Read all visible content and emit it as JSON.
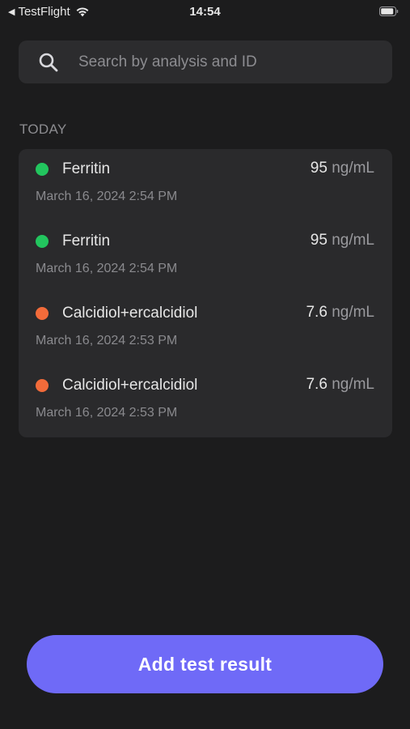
{
  "status_bar": {
    "back_label": "TestFlight",
    "time": "14:54"
  },
  "search": {
    "placeholder": "Search by analysis and ID"
  },
  "section": {
    "title": "TODAY"
  },
  "results": [
    {
      "name": "Ferritin",
      "value": "95",
      "unit": "ng/mL",
      "date": "March 16, 2024 2:54 PM",
      "status_color": "#22c55e"
    },
    {
      "name": "Ferritin",
      "value": "95",
      "unit": "ng/mL",
      "date": "March 16, 2024 2:54 PM",
      "status_color": "#22c55e"
    },
    {
      "name": "Calcidiol+ercalcidiol",
      "value": "7.6",
      "unit": "ng/mL",
      "date": "March 16, 2024 2:53 PM",
      "status_color": "#f26b3a"
    },
    {
      "name": "Calcidiol+ercalcidiol",
      "value": "7.6",
      "unit": "ng/mL",
      "date": "March 16, 2024 2:53 PM",
      "status_color": "#f26b3a"
    }
  ],
  "actions": {
    "add_label": "Add test result"
  },
  "colors": {
    "background": "#1c1c1d",
    "card": "#2a2a2c",
    "accent": "#6f6af7"
  },
  "icons": {
    "back": "back-caret-icon",
    "wifi": "wifi-icon",
    "battery": "battery-icon",
    "search": "search-icon"
  }
}
